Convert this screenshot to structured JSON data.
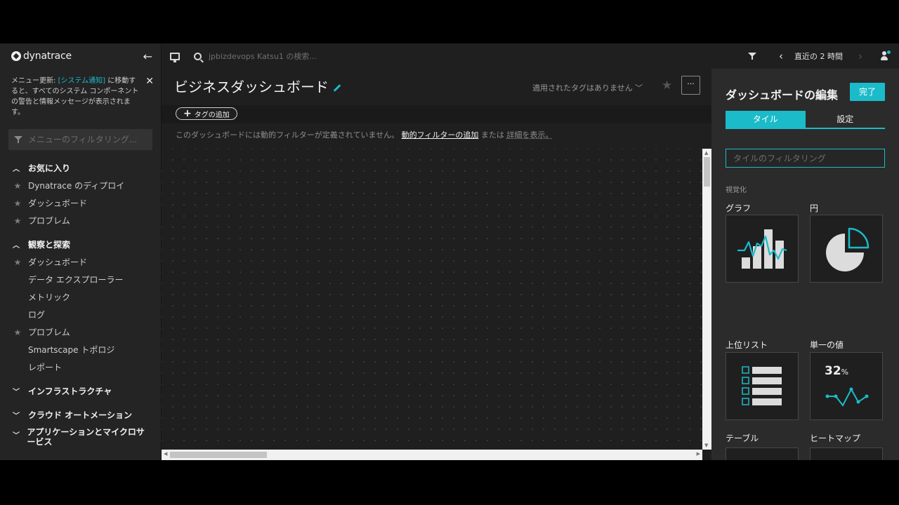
{
  "sidebar": {
    "logo_text": "dynatrace",
    "notice": {
      "prefix": "メニュー更新: ",
      "link": "[システム通知]",
      "suffix": " に移動すると、すべてのシステム コンポーネントの警告と情報メッセージが表示されます。"
    },
    "filter_placeholder": "メニューのフィルタリング...",
    "sections": {
      "favorites": "お気に入り",
      "observe": "観察と探索",
      "infra": "インフラストラクチャ",
      "cloud": "クラウド オートメーション",
      "apps": "アプリケーションとマイクロサービス"
    },
    "favorites": [
      "Dynatrace のディプロイ",
      "ダッシュボード",
      "プロブレム"
    ],
    "observe_items": [
      "ダッシュボード",
      "データ エクスプローラー",
      "メトリック",
      "ログ",
      "プロブレム",
      "Smartscape トポロジ",
      "レポート"
    ]
  },
  "topbar": {
    "search_placeholder": "jpbizdevops Katsu1 の検索...",
    "timeframe": "直近の 2 時間"
  },
  "main": {
    "title": "ビジネスダッシュボード",
    "tags_none": "適用されたタグはありません",
    "add_tag": "タグの追加",
    "more": "···",
    "filter_msg": {
      "text": "このダッシュボードには動的フィルターが定義されていません。",
      "add_link": "動的フィルターの追加",
      "or": "または",
      "details": "詳細を表示。"
    }
  },
  "panel": {
    "title": "ダッシュボードの編集",
    "done": "完了",
    "tabs": [
      "タイル",
      "設定"
    ],
    "tile_filter_placeholder": "タイルのフィルタリング",
    "viz_label": "視覚化",
    "tiles": [
      "グラフ",
      "円",
      "上位リスト",
      "単一の値",
      "テーブル",
      "ヒートマップ"
    ],
    "single_value": {
      "number": "32",
      "unit": "%"
    }
  },
  "colors": {
    "accent": "#1bbbc9",
    "background": "#1f1f1f",
    "sidebar": "#242424",
    "panel": "#2b2b2b"
  },
  "icons": [
    "dynatrace-logo-icon",
    "back-arrow-icon",
    "close-icon",
    "filter-icon",
    "monitor-icon",
    "search-icon",
    "chevron-left-icon",
    "chevron-right-icon",
    "user-icon",
    "star-icon",
    "pencil-icon",
    "plus-icon"
  ]
}
